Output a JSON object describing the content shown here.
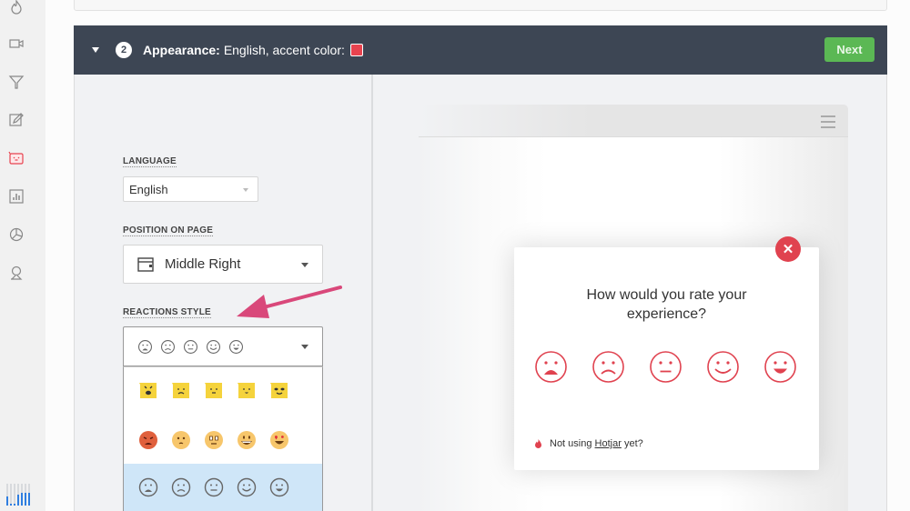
{
  "sidebar": {
    "items": [
      {
        "name": "heatmaps",
        "icon": "flame-icon",
        "active": false
      },
      {
        "name": "recordings",
        "icon": "video-camera-icon",
        "active": false
      },
      {
        "name": "funnels",
        "icon": "funnel-icon",
        "active": false
      },
      {
        "name": "forms",
        "icon": "edit-form-icon",
        "active": false
      },
      {
        "name": "incoming-feedback",
        "icon": "feedback-face-icon",
        "active": true
      },
      {
        "name": "polls",
        "icon": "bar-chart-icon",
        "active": false
      },
      {
        "name": "surveys",
        "icon": "pie-chart-icon",
        "active": false
      },
      {
        "name": "recruiters",
        "icon": "user-icon",
        "active": false
      }
    ],
    "active_color": "#e8434f"
  },
  "step": {
    "number": "2",
    "title": "Appearance:",
    "summary": "English, accent color:",
    "accent_color": "#e8434f",
    "next_label": "Next"
  },
  "form": {
    "language": {
      "label": "LANGUAGE",
      "value": "English"
    },
    "position": {
      "label": "POSITION ON PAGE",
      "value": "Middle Right"
    },
    "reactions": {
      "label": "REACTIONS STYLE",
      "options": [
        "yellow-square-emoji-set",
        "color-emoji-set",
        "outline-emoji-set"
      ],
      "selected": "outline-emoji-set"
    }
  },
  "preview": {
    "question": "How would you rate your experience?",
    "ratings": [
      "hate",
      "dislike",
      "neutral",
      "like",
      "love"
    ],
    "footer_prefix": "Not using",
    "footer_link": "Hotjar",
    "footer_suffix": "yet?",
    "accent_color": "#e0424f"
  },
  "annotation": {
    "arrow_color": "#d9487a",
    "points_to": "REACTIONS STYLE"
  }
}
